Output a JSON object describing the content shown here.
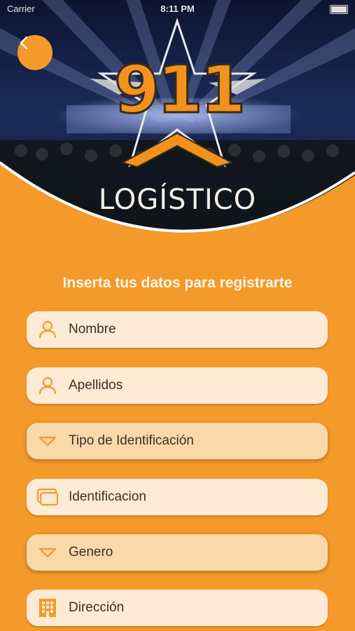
{
  "status_bar": {
    "carrier": "Carrier",
    "time": "8:11 PM"
  },
  "header": {
    "back_icon": "chevron-left-icon",
    "logo_number": "911",
    "logo_word": "LOGÍSTICO"
  },
  "title": "Inserta tus datos para registrarte",
  "fields": [
    {
      "label": "Nombre",
      "icon": "person-icon"
    },
    {
      "label": "Apellidos",
      "icon": "person-icon"
    },
    {
      "label": "Tipo de Identificación",
      "icon": "triangle-down-icon"
    },
    {
      "label": "Identificacion",
      "icon": "id-card-icon"
    },
    {
      "label": "Genero",
      "icon": "triangle-down-icon"
    },
    {
      "label": "Dirección",
      "icon": "building-icon"
    }
  ],
  "colors": {
    "accent": "#f39a2a",
    "field_bg": "#fdebd5",
    "select_bg": "#f9d8aa",
    "title_text": "#fff6e8"
  }
}
